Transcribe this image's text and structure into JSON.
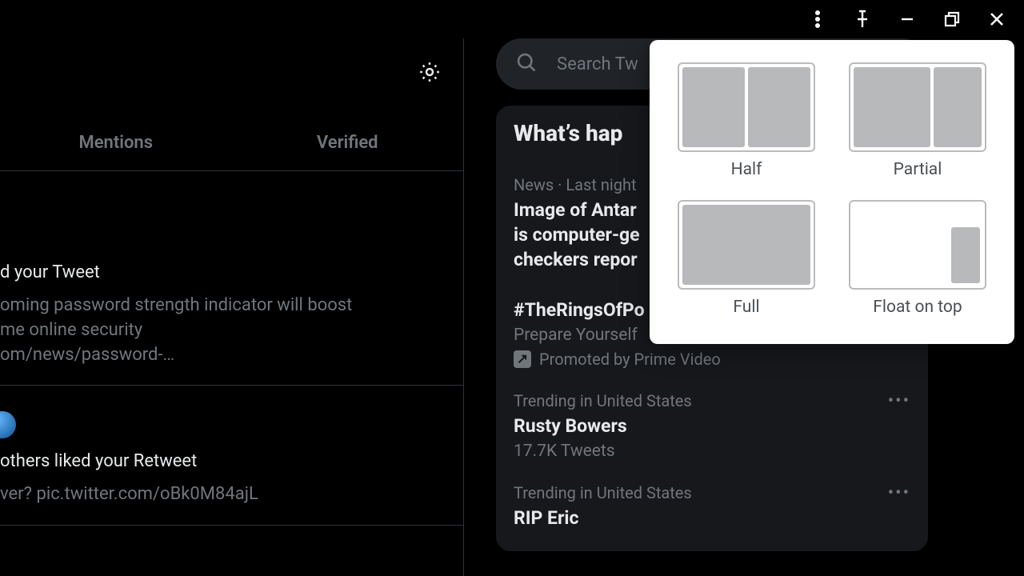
{
  "titlebar": {
    "more_icon": "more-vert-icon",
    "pin_icon": "pin-icon",
    "minimize_icon": "minimize-icon",
    "restore_icon": "restore-icon",
    "close_icon": "close-icon"
  },
  "left": {
    "tabs": {
      "mentions": "Mentions",
      "verified": "Verified"
    },
    "n1": {
      "title": "d your Tweet",
      "l1": "oming password strength indicator will boost",
      "l2": "me online security",
      "l3": "om/news/password-…"
    },
    "n2": {
      "title": "others liked your Retweet",
      "l1": "ver? pic.twitter.com/oBk0M84ajL"
    }
  },
  "search": {
    "placeholder": "Search Tw"
  },
  "whats_happening": {
    "heading": "What’s hap",
    "t1": {
      "meta": "News · Last night",
      "l1": "Image of Antar",
      "l2": "is computer-ge",
      "l3": "checkers repor"
    },
    "t2": {
      "title": "#TheRingsOfPo",
      "sub": "Prepare Yourself",
      "promo": "Promoted by Prime Video"
    },
    "t3": {
      "meta": "Trending in United States",
      "title": "Rusty Bowers",
      "sub": "17.7K Tweets"
    },
    "t4": {
      "meta": "Trending in United States",
      "title": "RIP Eric"
    }
  },
  "popup": {
    "half": "Half",
    "partial": "Partial",
    "full": "Full",
    "float": "Float on top"
  }
}
